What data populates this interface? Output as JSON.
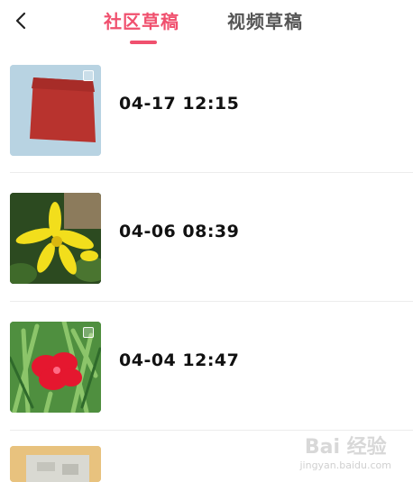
{
  "header": {
    "tabs": [
      {
        "label": "社区草稿",
        "active": true
      },
      {
        "label": "视频草稿",
        "active": false
      }
    ],
    "accent_color": "#f0506e"
  },
  "drafts": [
    {
      "time": "04-17 12:15",
      "thumbnail": "red-fabric-photo"
    },
    {
      "time": "04-06 08:39",
      "thumbnail": "yellow-lily-photo"
    },
    {
      "time": "04-04 12:47",
      "thumbnail": "red-flower-photo"
    }
  ],
  "watermark": {
    "brand": "Bai 经验",
    "url": "jingyan.baidu.com"
  }
}
